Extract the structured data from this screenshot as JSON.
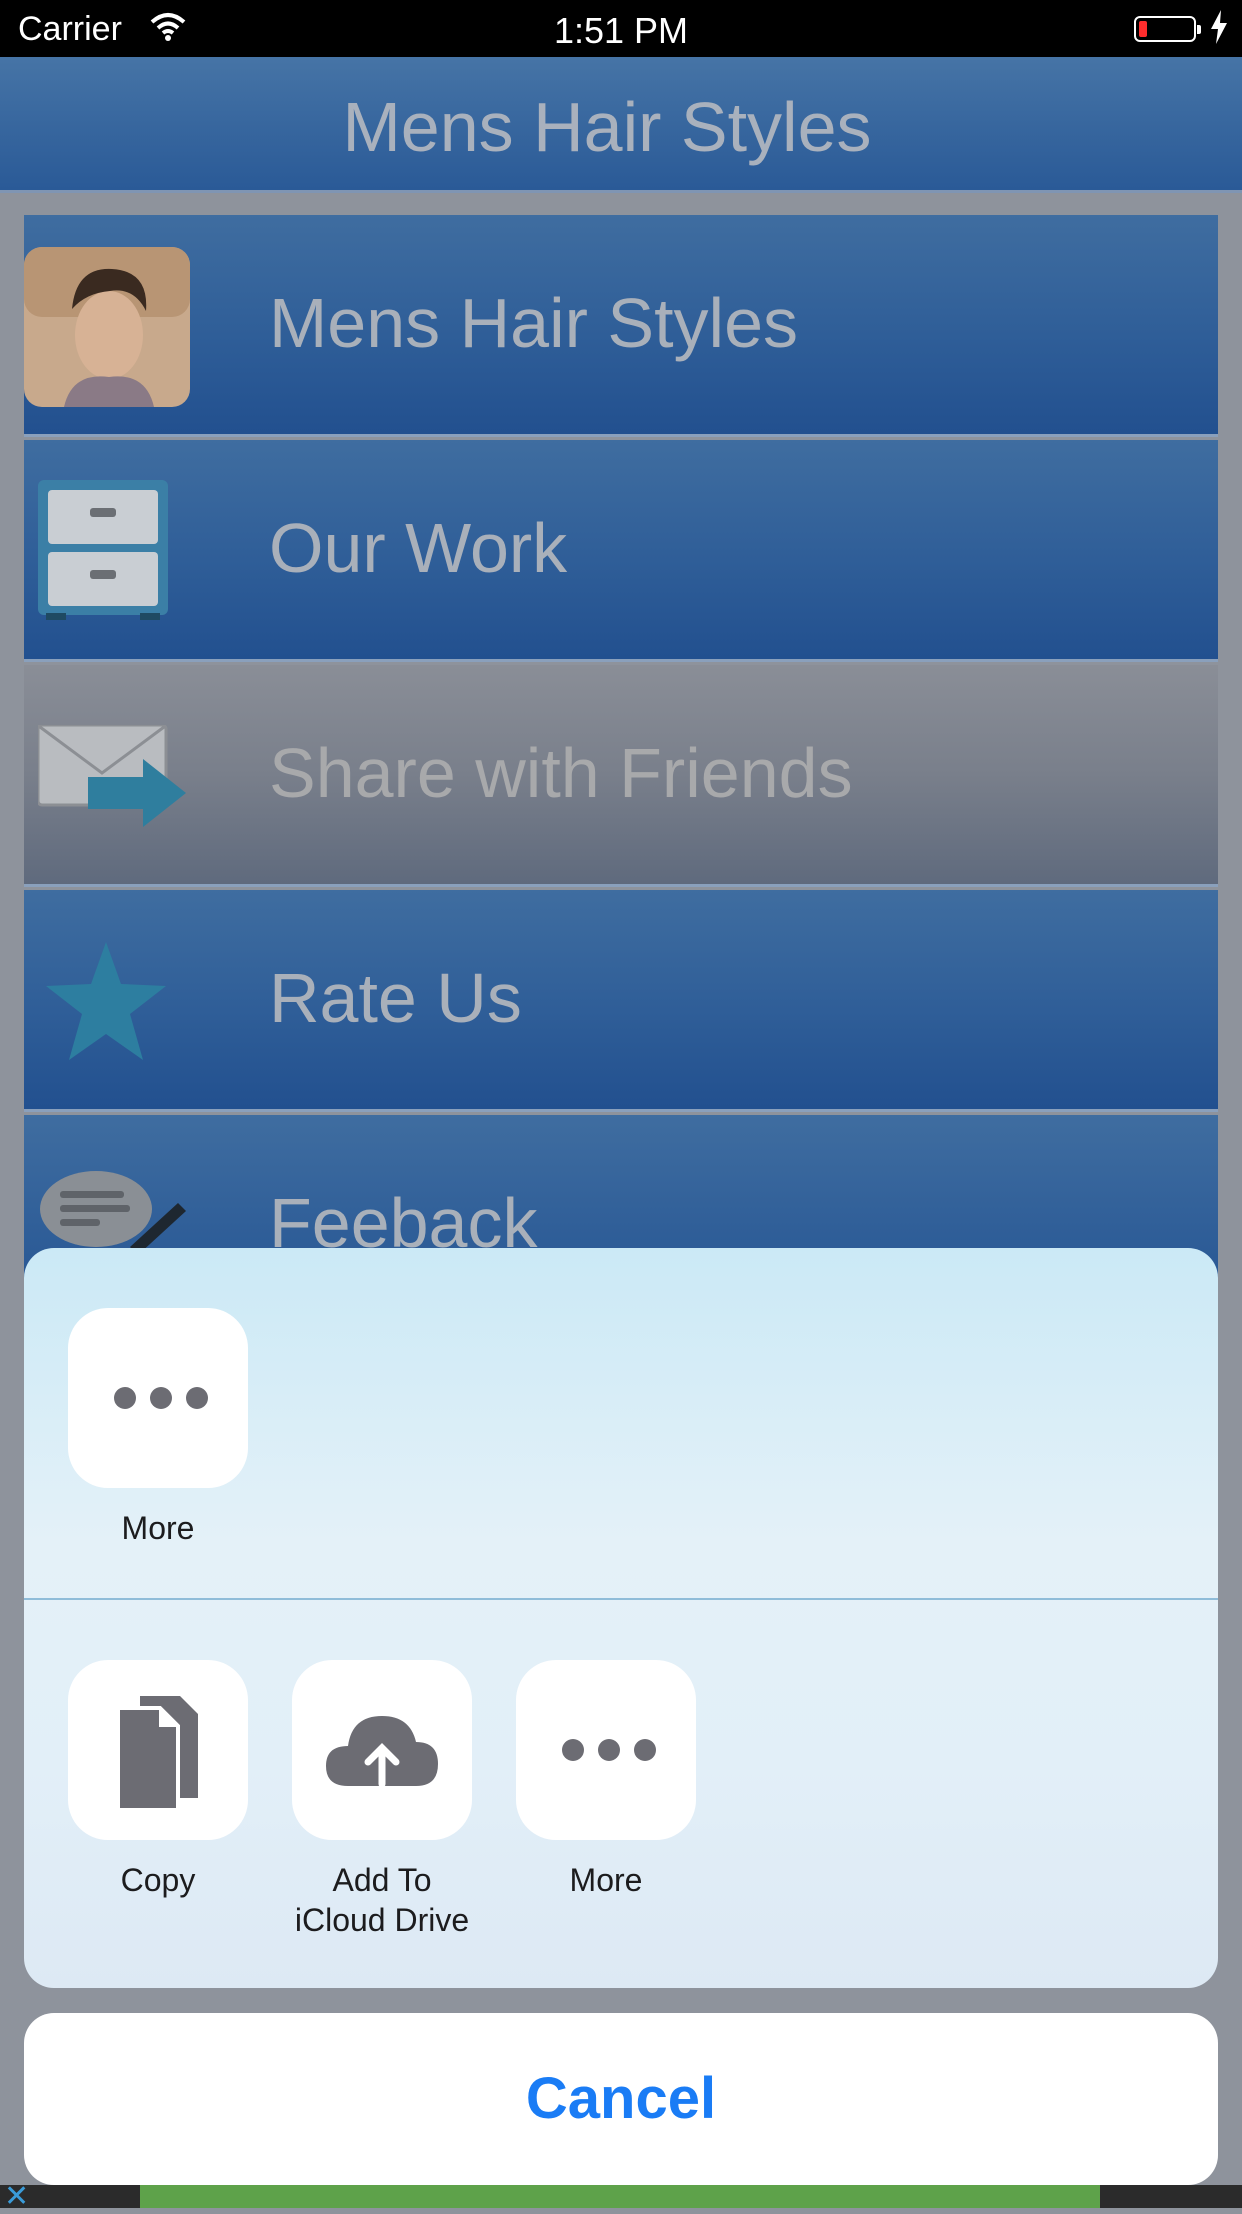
{
  "status_bar": {
    "carrier": "Carrier",
    "time": "1:51 PM",
    "battery_level": 0.1
  },
  "navbar": {
    "title": "Mens Hair Styles"
  },
  "menu": {
    "items": [
      {
        "label": "Mens Hair Styles",
        "icon": "portrait-icon"
      },
      {
        "label": "Our Work",
        "icon": "cabinet-icon"
      },
      {
        "label": "Share with Friends",
        "icon": "envelope-share-icon"
      },
      {
        "label": "Rate Us",
        "icon": "star-icon"
      },
      {
        "label": "Feeback",
        "icon": "chat-pen-icon"
      }
    ]
  },
  "share_sheet": {
    "top_actions": [
      {
        "label": "More",
        "icon": "more-dots-icon"
      }
    ],
    "bottom_actions": [
      {
        "label": "Copy",
        "icon": "copy-icon"
      },
      {
        "label": "Add To\niCloud Drive",
        "icon": "icloud-upload-icon"
      },
      {
        "label": "More",
        "icon": "more-dots-icon"
      }
    ],
    "cancel_label": "Cancel"
  },
  "colors": {
    "navbar": "#3b6aa0",
    "accent": "#1a7cf5",
    "sheet_bg": "#e2eff8"
  }
}
